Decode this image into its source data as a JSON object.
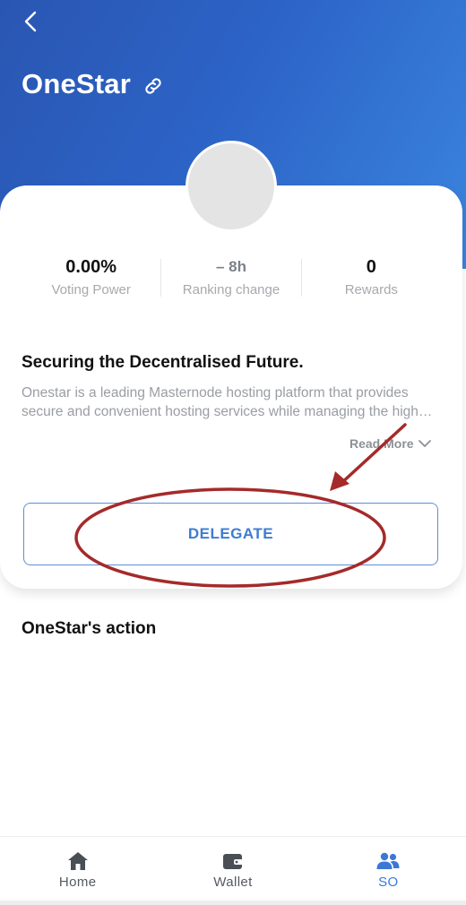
{
  "header": {
    "title": "OneStar",
    "back_icon": "chevron-left-icon",
    "link_icon": "link-icon"
  },
  "stats": [
    {
      "value": "0.00%",
      "label": "Voting Power"
    },
    {
      "value": "– 8h",
      "label": "Ranking change"
    },
    {
      "value": "0",
      "label": "Rewards"
    }
  ],
  "about": {
    "title": "Securing the Decentralised Future.",
    "line1": "Onestar is a leading Masternode hosting platform that provides",
    "line2": "secure and convenient hosting services while managing the high…",
    "read_more": "Read More"
  },
  "delegate_label": "DELEGATE",
  "actions_title": "OneStar's action",
  "nav": [
    {
      "label": "Home",
      "icon": "home-icon",
      "active": false
    },
    {
      "label": "Wallet",
      "icon": "wallet-icon",
      "active": false
    },
    {
      "label": "SO",
      "icon": "users-icon",
      "active": true
    }
  ],
  "colors": {
    "header_start": "#2a56b2",
    "header_end": "#3a84de",
    "accent": "#3e7cd3",
    "annotation": "#a52a2a"
  }
}
